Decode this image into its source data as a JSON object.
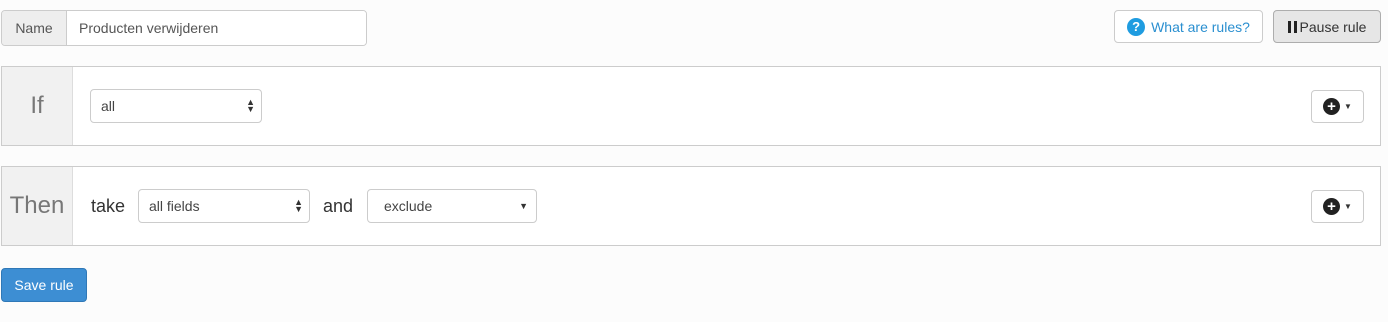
{
  "name_field": {
    "label": "Name",
    "value": "Producten verwijderen"
  },
  "header": {
    "help_label": "What are rules?",
    "help_icon_glyph": "?",
    "pause_label": "Pause rule"
  },
  "if_panel": {
    "label": "If",
    "condition_select": "all"
  },
  "then_panel": {
    "label": "Then",
    "take_word": "take",
    "fields_select": "all fields",
    "and_word": "and",
    "action_select": "exclude"
  },
  "icons": {
    "plus": "+",
    "caret_down": "▼",
    "caret_up": "▲"
  },
  "save_label": "Save rule",
  "colors": {
    "accent": "#3d8ed3",
    "help_link": "#2a8fd0"
  }
}
